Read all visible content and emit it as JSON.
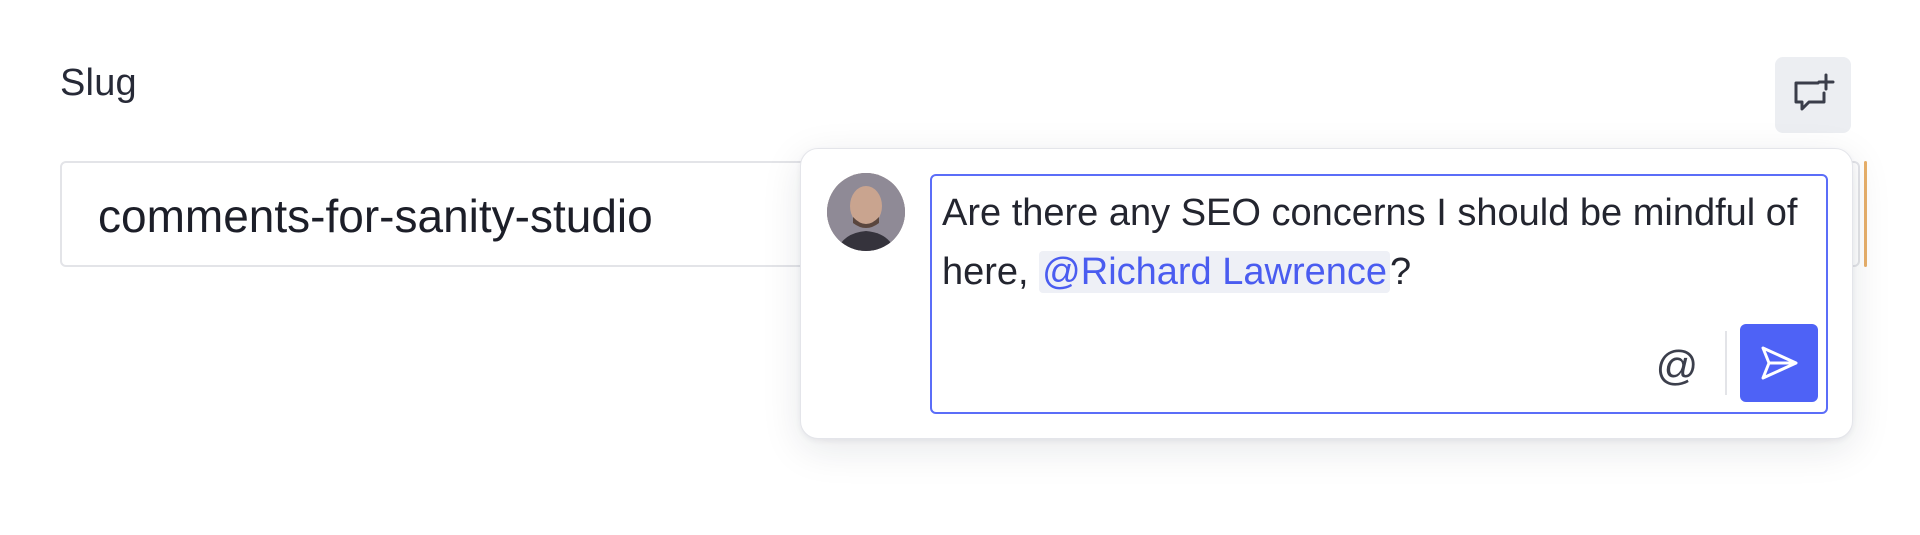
{
  "field": {
    "label": "Slug",
    "value": "comments-for-sanity-studio"
  },
  "add_comment": {
    "icon": "comment-add-icon"
  },
  "comment_composer": {
    "avatar": "avatar",
    "text_before": "Are there any SEO concerns I should be mindful of here, ",
    "mention": "@Richard Lawrence",
    "text_after": "?",
    "mention_button_label": "@",
    "send_icon": "send-icon"
  },
  "colors": {
    "accent": "#4e62f6",
    "mention_text": "#4a5cf0",
    "field_change_indicator": "#e8b06a"
  }
}
